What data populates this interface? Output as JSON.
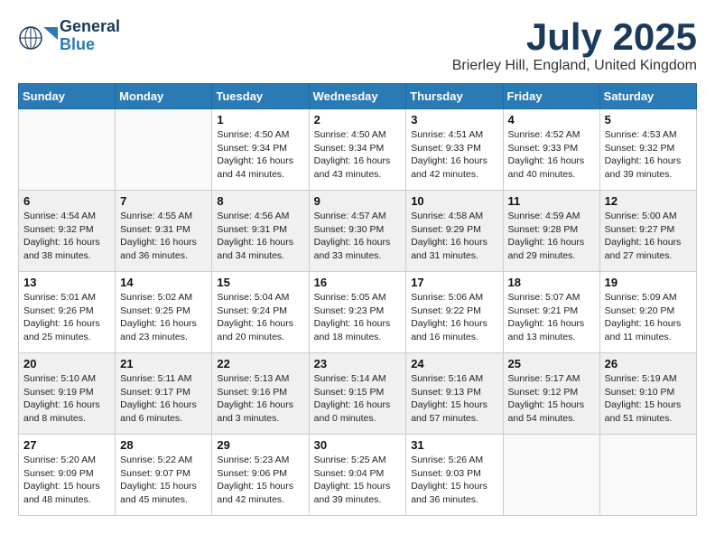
{
  "header": {
    "logo_general": "General",
    "logo_blue": "Blue",
    "month": "July 2025",
    "location": "Brierley Hill, England, United Kingdom"
  },
  "days_of_week": [
    "Sunday",
    "Monday",
    "Tuesday",
    "Wednesday",
    "Thursday",
    "Friday",
    "Saturday"
  ],
  "weeks": [
    [
      {
        "day": null,
        "info": null
      },
      {
        "day": null,
        "info": null
      },
      {
        "day": "1",
        "info": "Sunrise: 4:50 AM\nSunset: 9:34 PM\nDaylight: 16 hours\nand 44 minutes."
      },
      {
        "day": "2",
        "info": "Sunrise: 4:50 AM\nSunset: 9:34 PM\nDaylight: 16 hours\nand 43 minutes."
      },
      {
        "day": "3",
        "info": "Sunrise: 4:51 AM\nSunset: 9:33 PM\nDaylight: 16 hours\nand 42 minutes."
      },
      {
        "day": "4",
        "info": "Sunrise: 4:52 AM\nSunset: 9:33 PM\nDaylight: 16 hours\nand 40 minutes."
      },
      {
        "day": "5",
        "info": "Sunrise: 4:53 AM\nSunset: 9:32 PM\nDaylight: 16 hours\nand 39 minutes."
      }
    ],
    [
      {
        "day": "6",
        "info": "Sunrise: 4:54 AM\nSunset: 9:32 PM\nDaylight: 16 hours\nand 38 minutes."
      },
      {
        "day": "7",
        "info": "Sunrise: 4:55 AM\nSunset: 9:31 PM\nDaylight: 16 hours\nand 36 minutes."
      },
      {
        "day": "8",
        "info": "Sunrise: 4:56 AM\nSunset: 9:31 PM\nDaylight: 16 hours\nand 34 minutes."
      },
      {
        "day": "9",
        "info": "Sunrise: 4:57 AM\nSunset: 9:30 PM\nDaylight: 16 hours\nand 33 minutes."
      },
      {
        "day": "10",
        "info": "Sunrise: 4:58 AM\nSunset: 9:29 PM\nDaylight: 16 hours\nand 31 minutes."
      },
      {
        "day": "11",
        "info": "Sunrise: 4:59 AM\nSunset: 9:28 PM\nDaylight: 16 hours\nand 29 minutes."
      },
      {
        "day": "12",
        "info": "Sunrise: 5:00 AM\nSunset: 9:27 PM\nDaylight: 16 hours\nand 27 minutes."
      }
    ],
    [
      {
        "day": "13",
        "info": "Sunrise: 5:01 AM\nSunset: 9:26 PM\nDaylight: 16 hours\nand 25 minutes."
      },
      {
        "day": "14",
        "info": "Sunrise: 5:02 AM\nSunset: 9:25 PM\nDaylight: 16 hours\nand 23 minutes."
      },
      {
        "day": "15",
        "info": "Sunrise: 5:04 AM\nSunset: 9:24 PM\nDaylight: 16 hours\nand 20 minutes."
      },
      {
        "day": "16",
        "info": "Sunrise: 5:05 AM\nSunset: 9:23 PM\nDaylight: 16 hours\nand 18 minutes."
      },
      {
        "day": "17",
        "info": "Sunrise: 5:06 AM\nSunset: 9:22 PM\nDaylight: 16 hours\nand 16 minutes."
      },
      {
        "day": "18",
        "info": "Sunrise: 5:07 AM\nSunset: 9:21 PM\nDaylight: 16 hours\nand 13 minutes."
      },
      {
        "day": "19",
        "info": "Sunrise: 5:09 AM\nSunset: 9:20 PM\nDaylight: 16 hours\nand 11 minutes."
      }
    ],
    [
      {
        "day": "20",
        "info": "Sunrise: 5:10 AM\nSunset: 9:19 PM\nDaylight: 16 hours\nand 8 minutes."
      },
      {
        "day": "21",
        "info": "Sunrise: 5:11 AM\nSunset: 9:17 PM\nDaylight: 16 hours\nand 6 minutes."
      },
      {
        "day": "22",
        "info": "Sunrise: 5:13 AM\nSunset: 9:16 PM\nDaylight: 16 hours\nand 3 minutes."
      },
      {
        "day": "23",
        "info": "Sunrise: 5:14 AM\nSunset: 9:15 PM\nDaylight: 16 hours\nand 0 minutes."
      },
      {
        "day": "24",
        "info": "Sunrise: 5:16 AM\nSunset: 9:13 PM\nDaylight: 15 hours\nand 57 minutes."
      },
      {
        "day": "25",
        "info": "Sunrise: 5:17 AM\nSunset: 9:12 PM\nDaylight: 15 hours\nand 54 minutes."
      },
      {
        "day": "26",
        "info": "Sunrise: 5:19 AM\nSunset: 9:10 PM\nDaylight: 15 hours\nand 51 minutes."
      }
    ],
    [
      {
        "day": "27",
        "info": "Sunrise: 5:20 AM\nSunset: 9:09 PM\nDaylight: 15 hours\nand 48 minutes."
      },
      {
        "day": "28",
        "info": "Sunrise: 5:22 AM\nSunset: 9:07 PM\nDaylight: 15 hours\nand 45 minutes."
      },
      {
        "day": "29",
        "info": "Sunrise: 5:23 AM\nSunset: 9:06 PM\nDaylight: 15 hours\nand 42 minutes."
      },
      {
        "day": "30",
        "info": "Sunrise: 5:25 AM\nSunset: 9:04 PM\nDaylight: 15 hours\nand 39 minutes."
      },
      {
        "day": "31",
        "info": "Sunrise: 5:26 AM\nSunset: 9:03 PM\nDaylight: 15 hours\nand 36 minutes."
      },
      {
        "day": null,
        "info": null
      },
      {
        "day": null,
        "info": null
      }
    ]
  ]
}
